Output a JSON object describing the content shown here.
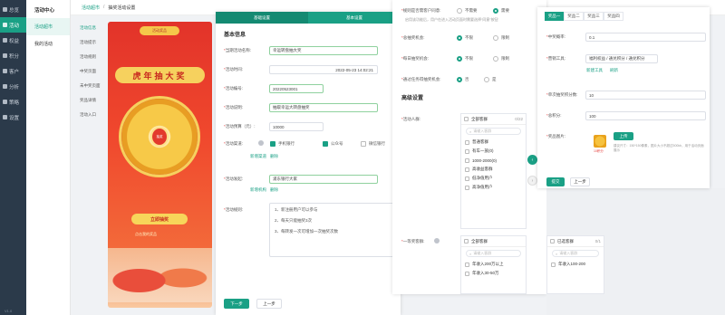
{
  "rail": {
    "items": [
      {
        "label": "总览"
      },
      {
        "label": "活动"
      },
      {
        "label": "权益"
      },
      {
        "label": "积分"
      },
      {
        "label": "客户"
      },
      {
        "label": "分析"
      },
      {
        "label": "策略"
      },
      {
        "label": "设置"
      }
    ],
    "version": "V1.0"
  },
  "submenu": {
    "title": "活动中心",
    "items": [
      {
        "label": "活动超市"
      },
      {
        "label": "我的活动"
      }
    ]
  },
  "breadcrumb": {
    "items": [
      "活动超市",
      "/",
      "抽奖活动设置"
    ]
  },
  "third_menu": {
    "items": [
      "活动信息",
      "活动提示",
      "活动规则",
      "中奖页面",
      "未中奖页面",
      "奖品详情",
      "活动入口"
    ]
  },
  "phone_preview": {
    "banner": "活动奖品",
    "title": "虎年抽大奖",
    "cta": "立即抽奖",
    "cta_sub": "抽奖",
    "footer": "点击我的奖品"
  },
  "form": {
    "steps": [
      "基础设置",
      "基本设置"
    ],
    "section_title": "基本信息",
    "fields": [
      {
        "label": "当期活动名称:",
        "value": "幸运转盘抽大奖"
      },
      {
        "label": "活动时间:",
        "value": "2022-05-23 14:02:21"
      },
      {
        "label": "活动编号:",
        "value": "20220523001"
      },
      {
        "label": "活动说明:",
        "value": "抽取幸运大转盘抽奖"
      },
      {
        "label": "活动预算（元）:",
        "value": "10000"
      }
    ],
    "channel_label": "活动渠道:",
    "channels": [
      "手机银行",
      "公众号",
      "微信银行"
    ],
    "add_channel": "新增渠道",
    "delete_channel": "删除",
    "org_label": "活动发起:",
    "org_value": "浦东银行大家",
    "add_org": "新增机构",
    "delete_org": "删除",
    "rules_label": "活动规则:",
    "rules": [
      "1、新注册用户可以参与",
      "2、每天只能抽奖3次",
      "3、每转发一次可增加一次抽奖次数"
    ],
    "next_button": "下一步",
    "prev_button": "上一步"
  },
  "mid": {
    "q1_label": "规则是否需客户同意:",
    "q1_options": [
      "不需要",
      "需要"
    ],
    "q1_hint": "启用该功能后，用户在进入活动页面时需要选择“同意”按钮",
    "q2_label": "总抽奖机会:",
    "q2_options": [
      "不限",
      "限制"
    ],
    "q3_label": "每日抽奖机会:",
    "q3_options": [
      "不限",
      "限制"
    ],
    "q4_label": "通过任务得抽奖机会:",
    "q4_options": [
      "否",
      "是"
    ],
    "advanced_title": "高级设置",
    "crowd_label": "活动人群:",
    "crowd_header": "全部客群",
    "crowd_count": "0/22",
    "crowd_search": "请输入客群",
    "crowd_items": [
      "普通客群",
      "有车一族(0)",
      "1000-2000(0)",
      "高收益客群",
      "低净值用户",
      "高净值用户"
    ],
    "tier_label": "一等奖客群:",
    "tier_header": "全部客群",
    "tier_search": "请输入客群",
    "tier_items": [
      "年收入200万以上",
      "年收入30-50万"
    ],
    "selected_header": "已选客群",
    "selected_count": "0/1",
    "selected_search": "请输入客群",
    "selected_items": [
      "年收入100-200"
    ]
  },
  "right": {
    "tabs": [
      "奖品一",
      "奖品二",
      "奖品三",
      "奖品四"
    ],
    "prize_name_label": "中奖概率:",
    "prize_name_value": "0.1",
    "tool_label": "营销工具:",
    "tool_value": "福利权益 / 通兑积分 / 通兑积分",
    "tool_add": "新建工具",
    "tool_refresh": "刷新",
    "points_label": "单次抽奖积分数:",
    "points_value": "10",
    "total_label": "总积分:",
    "total_value": "100",
    "image_label": "奖品图片:",
    "upload_button": "上传",
    "image_caption": "10积分",
    "image_hint": "建议尺寸：150*150像素，图片大小不超过500kb，用于活动页面展示",
    "confirm_button": "提交",
    "prev_button": "上一步"
  },
  "colors": {
    "accent": "#1aa085",
    "rail": "#2b3a4a"
  }
}
